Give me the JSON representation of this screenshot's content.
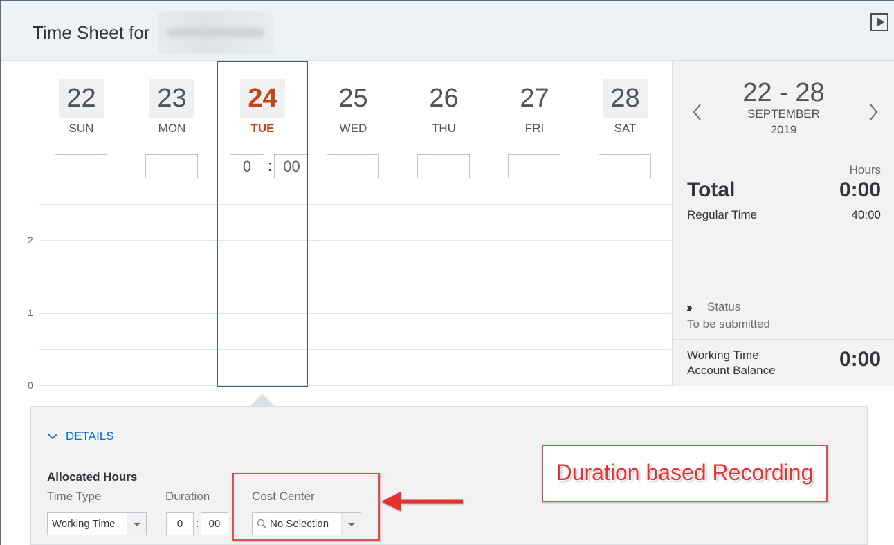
{
  "header": {
    "title": "Time Sheet for",
    "play_icon": "play-icon"
  },
  "week": {
    "days": [
      {
        "num": "22",
        "name": "SUN",
        "hours": ""
      },
      {
        "num": "23",
        "name": "MON",
        "hours": ""
      },
      {
        "num": "24",
        "name": "TUE",
        "hours_h": "0",
        "hours_sep": ":",
        "hours_m": "00",
        "today": true
      },
      {
        "num": "25",
        "name": "WED",
        "hours": ""
      },
      {
        "num": "26",
        "name": "THU",
        "hours": ""
      },
      {
        "num": "27",
        "name": "FRI",
        "hours": ""
      },
      {
        "num": "28",
        "name": "SAT",
        "hours": ""
      }
    ],
    "y_axis": [
      "2",
      "1",
      "0"
    ],
    "today_color": "#c1461a"
  },
  "summary": {
    "range": "22 - 28",
    "month": "SEPTEMBER",
    "year": "2019",
    "hours_label": "Hours",
    "total_label": "Total",
    "total_value": "0:00",
    "regular_label": "Regular Time",
    "regular_value": "40:00",
    "status_label": "Status",
    "status_value": "To be submitted",
    "wt_label_1": "Working Time",
    "wt_label_2": "Account Balance",
    "wt_value": "0:00"
  },
  "details": {
    "toggle_label": "DETAILS",
    "allocated_label": "Allocated Hours",
    "time_type_label": "Time Type",
    "time_type_value": "Working Time",
    "duration_label": "Duration",
    "duration_h": "0",
    "duration_sep": ":",
    "duration_m": "00",
    "cost_center_label": "Cost Center",
    "cost_center_value": "No Selection"
  },
  "annotation": {
    "label": "Duration based Recording",
    "color": "#e14b4b"
  }
}
